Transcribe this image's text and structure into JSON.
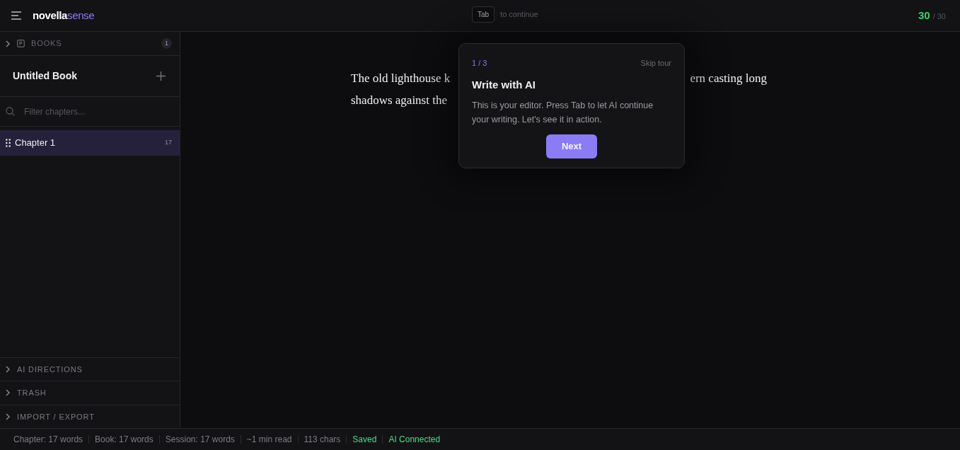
{
  "header": {
    "logo_main": "novella",
    "logo_accent": "sense",
    "hint_key": "Tab",
    "hint_text": "to continue",
    "credits_used": "30",
    "credits_total": "/ 30"
  },
  "sidebar": {
    "books_section": {
      "label": "BOOKS",
      "count": "1",
      "expanded": false
    },
    "book_title": "Untitled Book",
    "filter": {
      "placeholder": "Filter chapters..."
    },
    "chapters": [
      {
        "title": "Chapter 1",
        "count": "17",
        "selected": true
      }
    ],
    "sections": [
      {
        "label": "AI DIRECTIONS",
        "expanded": false
      },
      {
        "label": "TRASH",
        "expanded": false
      },
      {
        "label": "IMPORT / EXPORT",
        "expanded": false
      }
    ]
  },
  "editor": {
    "lines": [
      [
        "The old lighthouse k",
        "ern casting long"
      ],
      [
        "shadows against the"
      ]
    ]
  },
  "tour": {
    "step": "1 / 3",
    "skip": "Skip tour",
    "title": "Write with AI",
    "body": "This is your editor. Press Tab to let AI continue your writing. Let's see it in action.",
    "next": "Next"
  },
  "status_bar": [
    {
      "text": "Chapter: 17 words",
      "kind": "muted"
    },
    {
      "text": "Book: 17 words",
      "kind": "muted"
    },
    {
      "text": "Session: 17 words",
      "kind": "muted"
    },
    {
      "text": "~1 min read",
      "kind": "muted"
    },
    {
      "text": "113 chars",
      "kind": "muted"
    },
    {
      "text": "Saved",
      "kind": "ok"
    },
    {
      "text": "AI Connected",
      "kind": "ok"
    }
  ]
}
